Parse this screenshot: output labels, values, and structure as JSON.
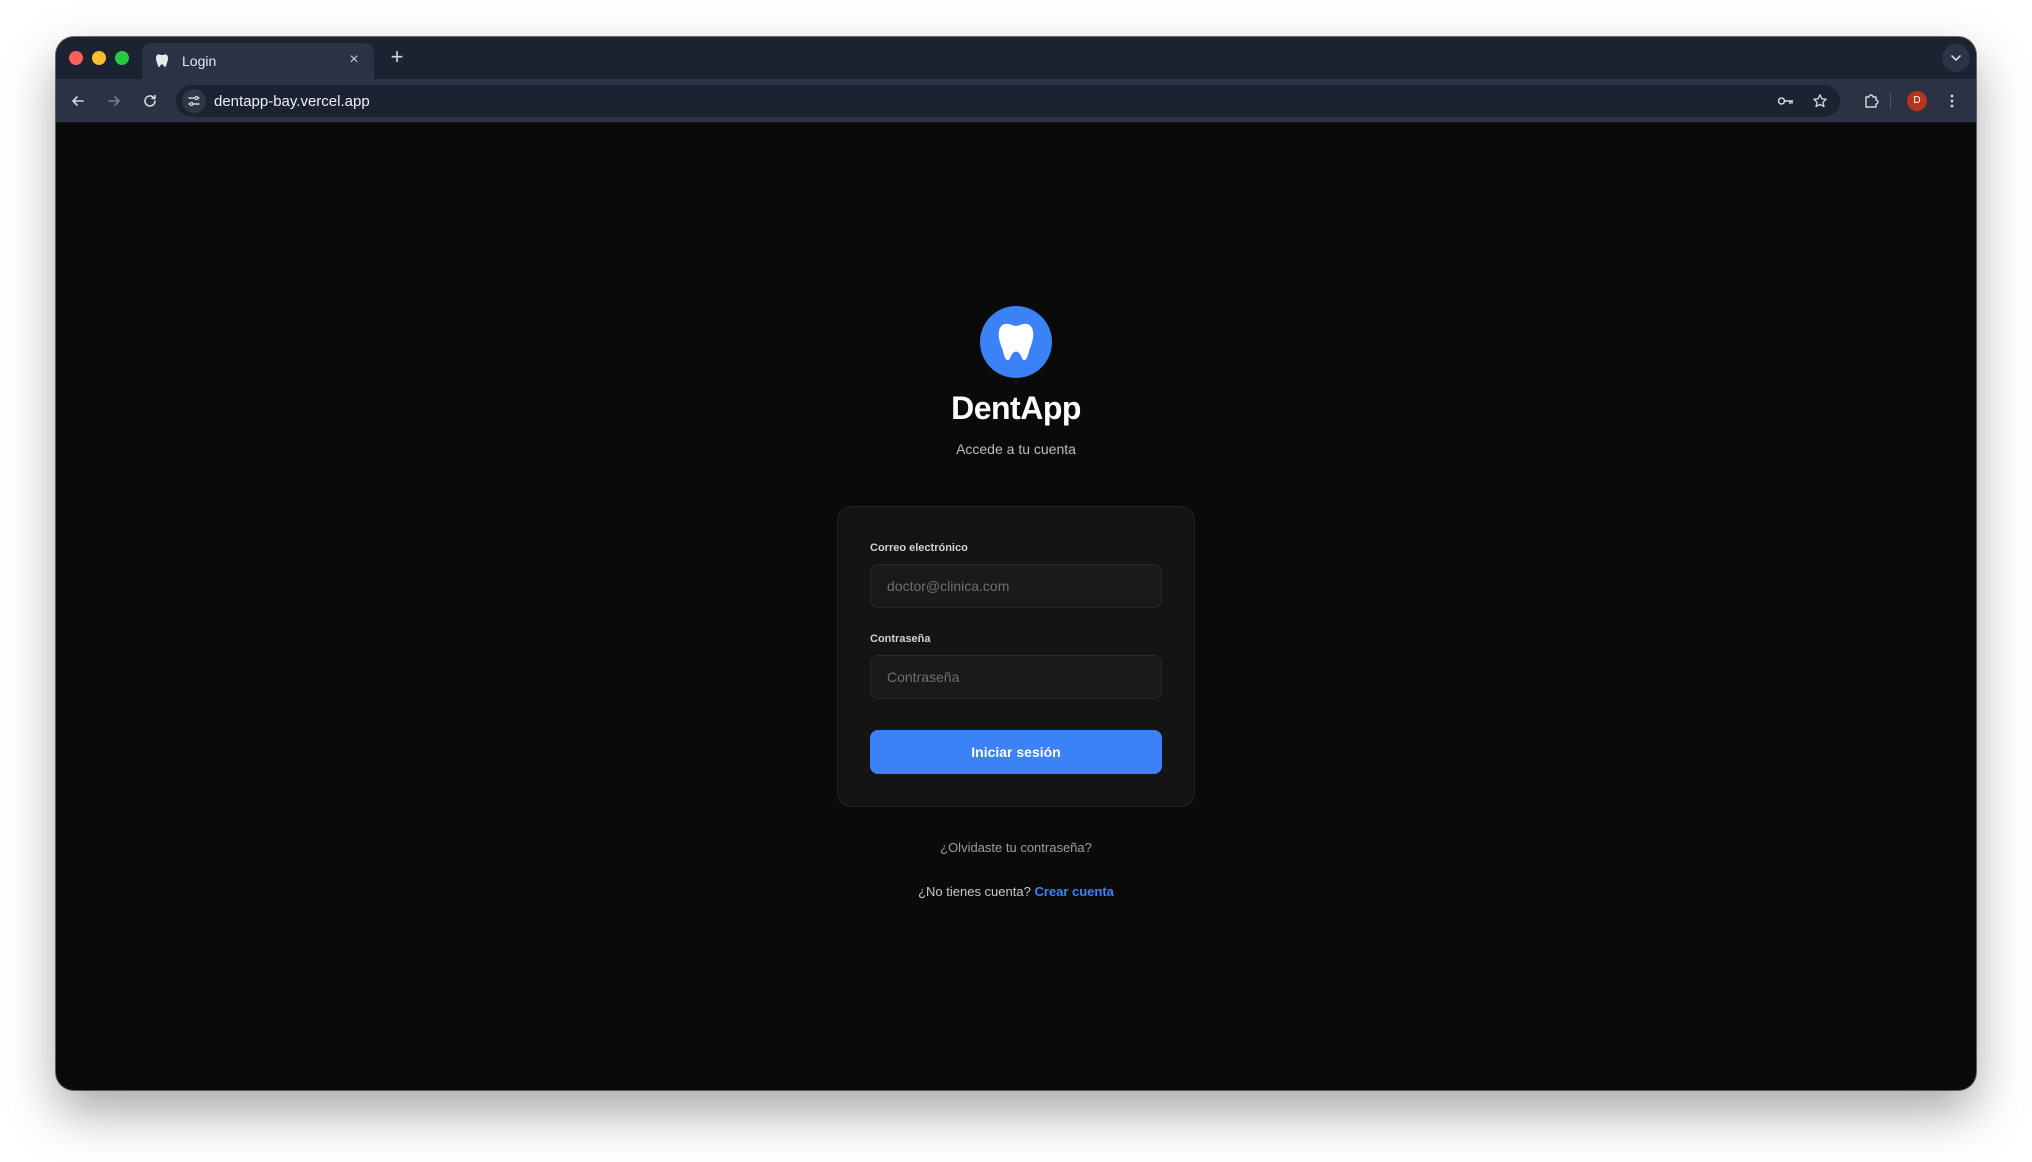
{
  "browser": {
    "tab": {
      "title": "Login",
      "close_glyph": "×"
    },
    "new_tab_glyph": "+",
    "url": "dentapp-bay.vercel.app",
    "profile_initial": "D",
    "icons": [
      "back-arrow-icon",
      "forward-arrow-icon",
      "reload-icon",
      "site-settings-icon",
      "password-key-icon",
      "bookmark-star-icon",
      "extensions-puzzle-icon",
      "more-vertical-icon",
      "tab-search-chevron-icon"
    ]
  },
  "login": {
    "brand": "DentApp",
    "subtitle": "Accede a tu cuenta",
    "email_label": "Correo electrónico",
    "email_placeholder": "doctor@clinica.com",
    "password_label": "Contraseña",
    "password_placeholder": "Contraseña",
    "submit_label": "Iniciar sesión",
    "forgot_link": "¿Olvidaste tu contraseña?",
    "no_account_text": "¿No tienes cuenta?",
    "create_account_link": "Crear cuenta"
  },
  "colors": {
    "accent": "#3b82f6",
    "background": "#0a0a0a",
    "card": "#141414"
  }
}
